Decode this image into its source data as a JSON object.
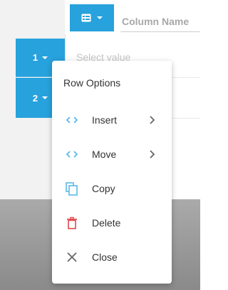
{
  "column_header": {
    "type_button_icon": "table-icon",
    "name_placeholder": "Column Name"
  },
  "rows": [
    {
      "label": "1"
    },
    {
      "label": "2"
    }
  ],
  "cell": {
    "placeholder": "Select value"
  },
  "context_menu": {
    "title": "Row Options",
    "items": [
      {
        "label": "Insert",
        "icon": "code-brackets-icon",
        "has_submenu": true
      },
      {
        "label": "Move",
        "icon": "code-brackets-icon",
        "has_submenu": true
      },
      {
        "label": "Copy",
        "icon": "copy-icon",
        "has_submenu": false
      },
      {
        "label": "Delete",
        "icon": "trash-icon",
        "has_submenu": false
      },
      {
        "label": "Close",
        "icon": "close-icon",
        "has_submenu": false
      }
    ]
  },
  "colors": {
    "accent": "#27a2dd",
    "delete": "#e0474c",
    "icon_blue": "#5cb9e4",
    "icon_gray": "#666666"
  }
}
